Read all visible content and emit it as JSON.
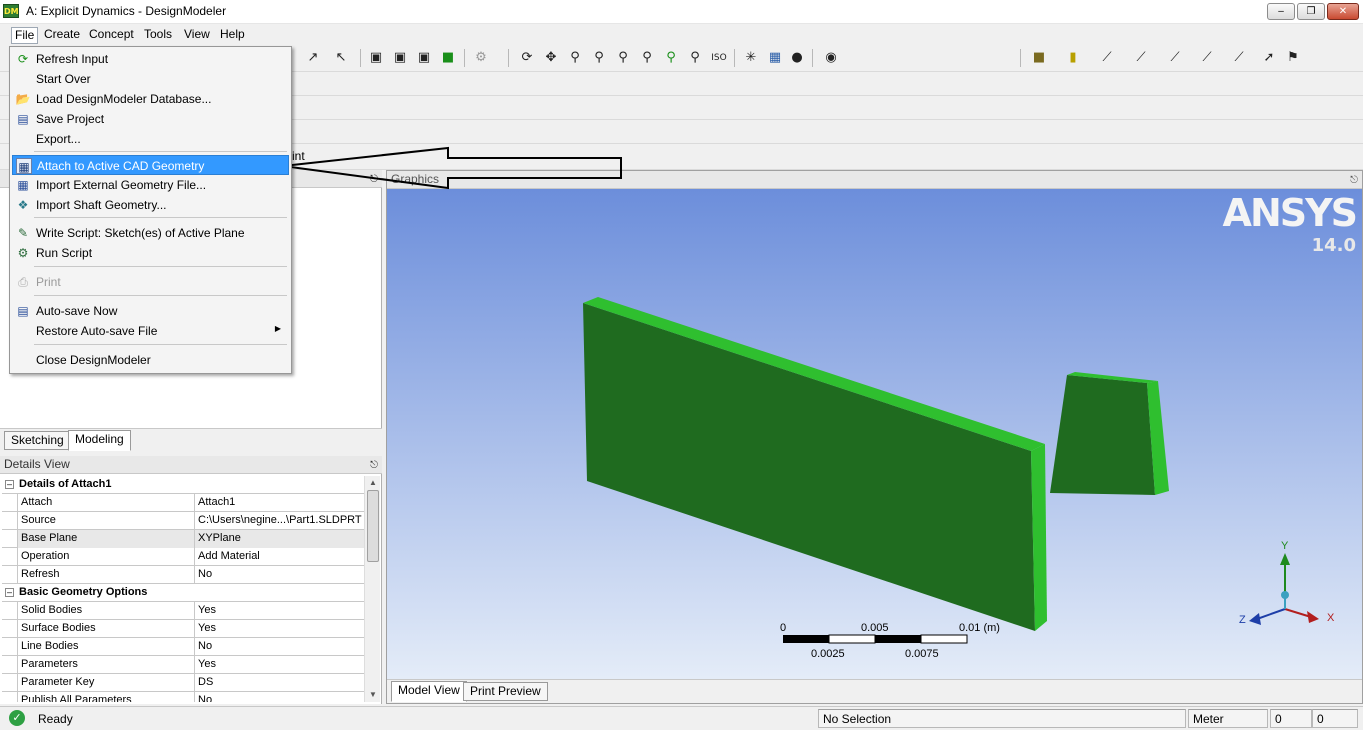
{
  "window": {
    "title": "A: Explicit Dynamics - DesignModeler",
    "app_icon": "DM"
  },
  "menubar": {
    "items": [
      "File",
      "Create",
      "Concept",
      "Tools",
      "View",
      "Help"
    ]
  },
  "file_menu": {
    "items": [
      {
        "label": "Refresh Input",
        "icon": "refresh-icon"
      },
      {
        "label": "Start Over",
        "icon": "start-over-icon"
      },
      {
        "label": "Load DesignModeler Database...",
        "icon": "folder-icon"
      },
      {
        "label": "Save Project",
        "icon": "save-icon"
      },
      {
        "label": "Export...",
        "icon": "export-icon"
      },
      {
        "label": "Attach to Active CAD Geometry",
        "icon": "cad-attach-icon"
      },
      {
        "label": "Import External Geometry File...",
        "icon": "import-geometry-icon"
      },
      {
        "label": "Import Shaft Geometry...",
        "icon": "shaft-icon"
      },
      {
        "label": "Write Script: Sketch(es) of Active Plane",
        "icon": "write-script-icon"
      },
      {
        "label": "Run Script",
        "icon": "run-script-icon"
      },
      {
        "label": "Print",
        "icon": "print-icon"
      },
      {
        "label": "Auto-save Now",
        "icon": "autosave-icon"
      },
      {
        "label": "Restore Auto-save File",
        "icon": ""
      },
      {
        "label": "Close DesignModeler",
        "icon": ""
      }
    ]
  },
  "toolbar_partial_text": "int",
  "tree_tabs": [
    "Sketching",
    "Modeling"
  ],
  "details": {
    "title": "Details View",
    "groups": [
      {
        "name": "Details of Attach1",
        "rows": [
          [
            "Attach",
            "Attach1"
          ],
          [
            "Source",
            "C:\\Users\\negine...\\Part1.SLDPRT"
          ],
          [
            "Base Plane",
            "XYPlane"
          ],
          [
            "Operation",
            "Add Material"
          ],
          [
            "Refresh",
            "No"
          ]
        ]
      },
      {
        "name": "Basic Geometry Options",
        "rows": [
          [
            "Solid Bodies",
            "Yes"
          ],
          [
            "Surface Bodies",
            "Yes"
          ],
          [
            "Line Bodies",
            "No"
          ],
          [
            "Parameters",
            "Yes"
          ],
          [
            "Parameter Key",
            "DS"
          ],
          [
            "Publish All Parameters",
            "No"
          ]
        ]
      }
    ]
  },
  "graphics": {
    "title": "Graphics",
    "logo": "ANSYS",
    "version": "14.0",
    "scale_top": [
      "0",
      "0.005",
      "0.01 (m)"
    ],
    "scale_bottom": [
      "0.0025",
      "0.0075"
    ],
    "axes": {
      "x": "X",
      "y": "Y",
      "z": "Z"
    },
    "tabs": [
      "Model View",
      "Print Preview"
    ]
  },
  "statusbar": {
    "status": "Ready",
    "selection": "No Selection",
    "units": "Meter",
    "coord1": "0",
    "coord2": "0"
  },
  "colors": {
    "body_face": "#1f6b1f",
    "body_edge": "#2fbf2f",
    "menu_highlight": "#3399ff",
    "viewport_top": "#6c8edb",
    "viewport_bottom": "#e4ecf8"
  }
}
